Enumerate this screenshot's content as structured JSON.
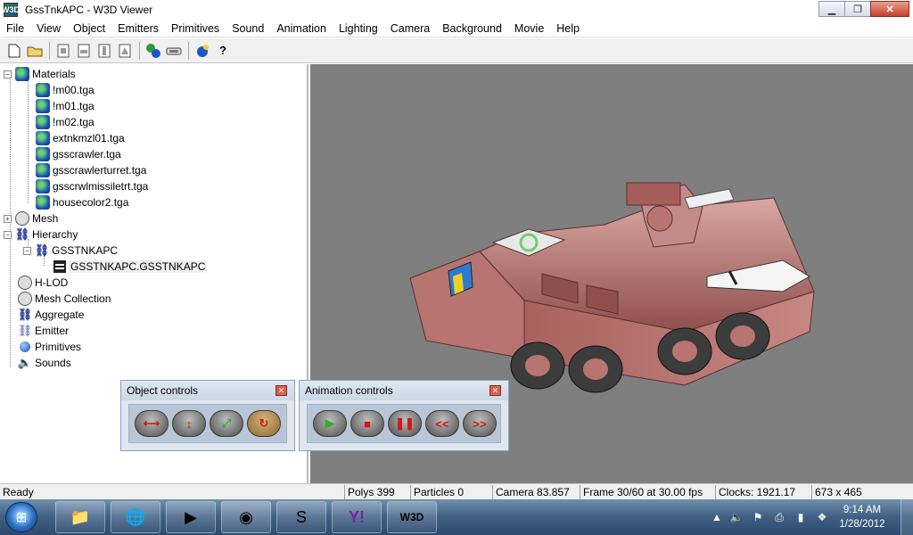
{
  "window": {
    "title": "GssTnkAPC - W3D Viewer",
    "icon_text": "W3D"
  },
  "menu": [
    "File",
    "View",
    "Object",
    "Emitters",
    "Primitives",
    "Sound",
    "Animation",
    "Lighting",
    "Camera",
    "Background",
    "Movie",
    "Help"
  ],
  "tree": {
    "materials_label": "Materials",
    "materials": [
      "!m00.tga",
      "!m01.tga",
      "!m02.tga",
      "extnkmzl01.tga",
      "gsscrawler.tga",
      "gsscrawlerturret.tga",
      "gsscrwlmissiletrt.tga",
      "housecolor2.tga"
    ],
    "mesh_label": "Mesh",
    "hierarchy_label": "Hierarchy",
    "hierarchy_child": "GSSTNKAPC",
    "hierarchy_grandchild": "GSSTNKAPC.GSSTNKAPC",
    "hlod_label": "H-LOD",
    "mesh_collection_label": "Mesh Collection",
    "aggregate_label": "Aggregate",
    "emitter_label": "Emitter",
    "primitives_label": "Primitives",
    "sounds_label": "Sounds"
  },
  "object_controls": {
    "title": "Object controls"
  },
  "animation_controls": {
    "title": "Animation controls",
    "rewind_label": "<<",
    "forward_label": ">>"
  },
  "status": {
    "ready": "Ready",
    "polys": "Polys 399",
    "particles": "Particles 0",
    "camera": "Camera 83.857",
    "frame": "Frame 30/60 at 30.00 fps",
    "clocks": "Clocks: 1921.17",
    "resolution": "673 x 465"
  },
  "taskbar": {
    "time": "9:14 AM",
    "date": "1/28/2012"
  },
  "colors": {
    "viewport_bg": "#7f7f7f",
    "tank_body": "#b06a66"
  }
}
